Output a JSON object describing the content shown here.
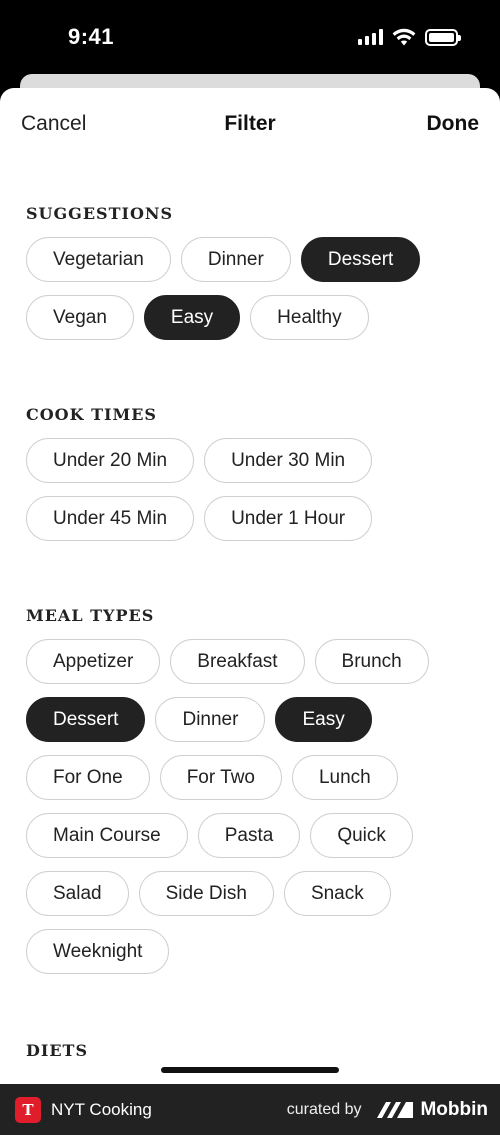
{
  "status_bar": {
    "time": "9:41"
  },
  "nav": {
    "cancel_label": "Cancel",
    "title": "Filter",
    "done_label": "Done"
  },
  "sections": {
    "suggestions": {
      "title": "SUGGESTIONS",
      "items": [
        {
          "label": "Vegetarian",
          "selected": false
        },
        {
          "label": "Dinner",
          "selected": false
        },
        {
          "label": "Dessert",
          "selected": true
        },
        {
          "label": "Vegan",
          "selected": false
        },
        {
          "label": "Easy",
          "selected": true
        },
        {
          "label": "Healthy",
          "selected": false
        }
      ]
    },
    "cook_times": {
      "title": "COOK TIMES",
      "items": [
        {
          "label": "Under 20 Min",
          "selected": false
        },
        {
          "label": "Under 30 Min",
          "selected": false
        },
        {
          "label": "Under 45 Min",
          "selected": false
        },
        {
          "label": "Under 1 Hour",
          "selected": false
        }
      ]
    },
    "meal_types": {
      "title": "MEAL TYPES",
      "items": [
        {
          "label": "Appetizer",
          "selected": false
        },
        {
          "label": "Breakfast",
          "selected": false
        },
        {
          "label": "Brunch",
          "selected": false
        },
        {
          "label": "Dessert",
          "selected": true
        },
        {
          "label": "Dinner",
          "selected": false
        },
        {
          "label": "Easy",
          "selected": true
        },
        {
          "label": "For One",
          "selected": false
        },
        {
          "label": "For Two",
          "selected": false
        },
        {
          "label": "Lunch",
          "selected": false
        },
        {
          "label": "Main Course",
          "selected": false
        },
        {
          "label": "Pasta",
          "selected": false
        },
        {
          "label": "Quick",
          "selected": false
        },
        {
          "label": "Salad",
          "selected": false
        },
        {
          "label": "Side Dish",
          "selected": false
        },
        {
          "label": "Snack",
          "selected": false
        },
        {
          "label": "Weeknight",
          "selected": false
        }
      ]
    },
    "diets": {
      "title": "DIETS"
    }
  },
  "footer": {
    "app_name": "NYT Cooking",
    "curated_by": "curated by",
    "brand": "Mobbin"
  },
  "colors": {
    "selected_chip": "#222222",
    "chip_border": "#cfcfcf",
    "brand_red": "#e01e2b",
    "footer_bg": "#222222"
  }
}
